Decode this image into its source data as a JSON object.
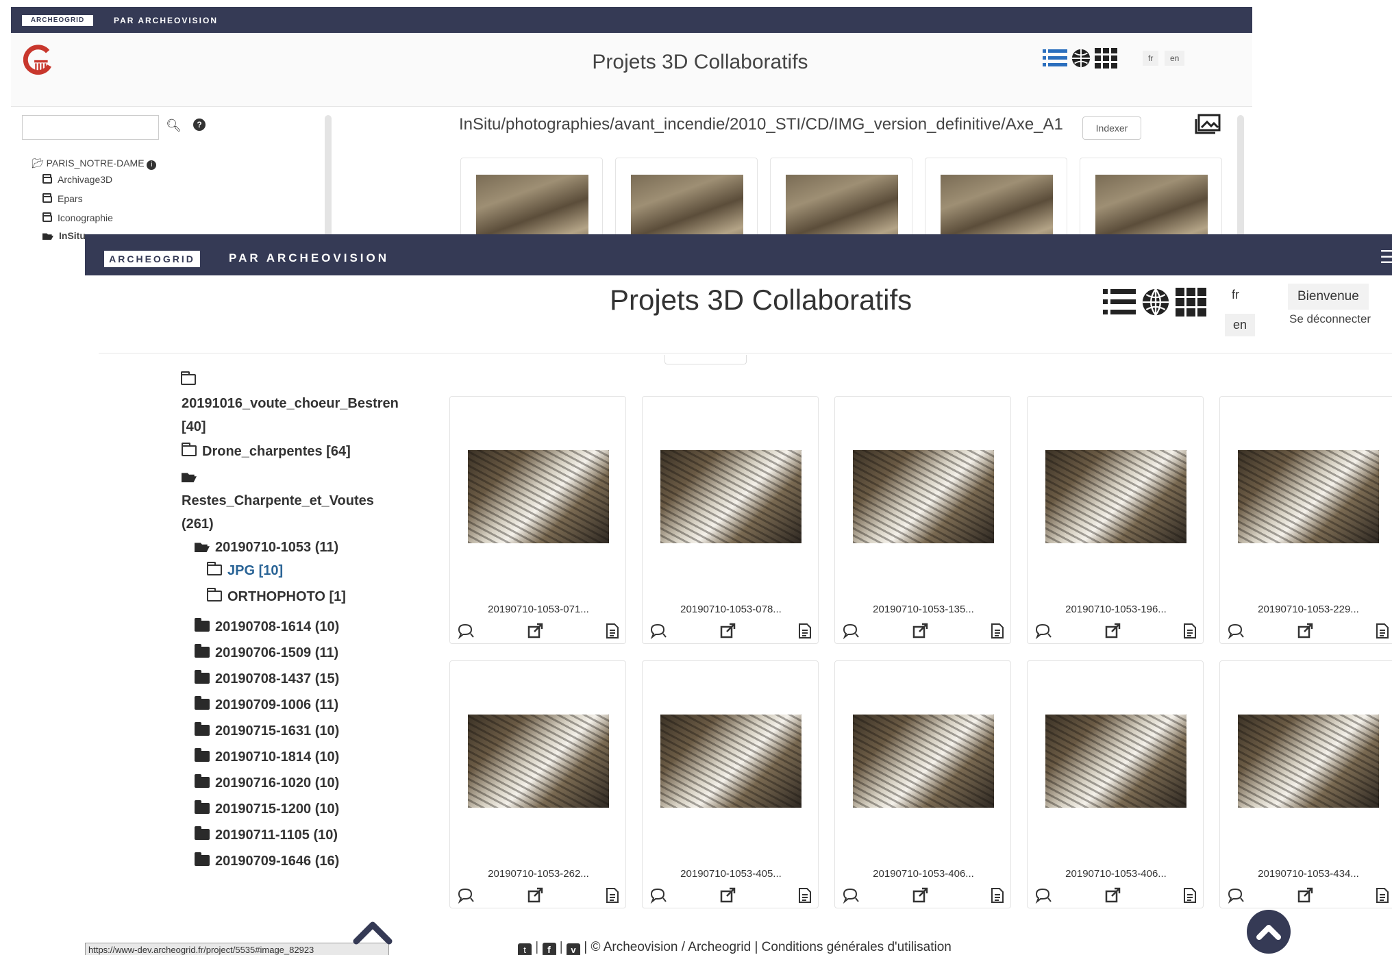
{
  "back": {
    "brand": "ARCHEOGRID",
    "brand_par": "PAR ARCHEOVISION",
    "title": "Projets 3D Collaboratifs",
    "lang_fr": "fr",
    "lang_en": "en",
    "tree": [
      "PARIS_NOTRE-DAME",
      "Archivage3D",
      "Epars",
      "Iconographie",
      "InSitu"
    ],
    "path": "InSitu/photographies/avant_incendie/2010_STI/CD/IMG_version_definitive/Axe_A1",
    "indexer_label": "Indexer"
  },
  "front": {
    "brand": "ARCHEOGRID",
    "brand_par": "PAR ARCHEOVISION",
    "title": "Projets 3D Collaboratifs",
    "lang_fr": "fr",
    "lang_en": "en",
    "welcome": "Bienvenue",
    "logout": "Se déconnecter",
    "tree": [
      {
        "label": "20191016_voute_choeur_Bestren",
        "icon": "folder-icon"
      },
      {
        "label": "[40]"
      },
      {
        "label": "Drone_charpentes [64]",
        "icon": "folder-icon"
      },
      {
        "label": "Restes_Charpente_et_Voutes",
        "icon": "folder-open-icon"
      },
      {
        "label": "(261)"
      },
      {
        "label": "20190710-1053 (11)",
        "icon": "folder-open-icon"
      },
      {
        "label": "JPG [10]",
        "icon": "folder-icon"
      },
      {
        "label": "ORTHOPHOTO [1]",
        "icon": "folder-icon"
      },
      {
        "label": "20190708-1614 (10)",
        "icon": "folder-solid-icon"
      },
      {
        "label": "20190706-1509 (11)",
        "icon": "folder-solid-icon"
      },
      {
        "label": "20190708-1437 (15)",
        "icon": "folder-solid-icon"
      },
      {
        "label": "20190709-1006 (11)",
        "icon": "folder-solid-icon"
      },
      {
        "label": "20190715-1631 (10)",
        "icon": "folder-solid-icon"
      },
      {
        "label": "20190710-1814 (10)",
        "icon": "folder-solid-icon"
      },
      {
        "label": "20190716-1020 (10)",
        "icon": "folder-solid-icon"
      },
      {
        "label": "20190715-1200 (10)",
        "icon": "folder-solid-icon"
      },
      {
        "label": "20190711-1105 (10)",
        "icon": "folder-solid-icon"
      },
      {
        "label": "20190709-1646 (16)",
        "icon": "folder-solid-icon"
      }
    ],
    "cards": [
      {
        "name": "20190710-1053-071..."
      },
      {
        "name": "20190710-1053-078..."
      },
      {
        "name": "20190710-1053-135..."
      },
      {
        "name": "20190710-1053-196..."
      },
      {
        "name": "20190710-1053-229..."
      },
      {
        "name": "20190710-1053-262..."
      },
      {
        "name": "20190710-1053-405..."
      },
      {
        "name": "20190710-1053-406..."
      },
      {
        "name": "20190710-1053-406..."
      },
      {
        "name": "20190710-1053-434..."
      }
    ],
    "footer": "| © Archeovision / Archeogrid | Conditions générales d'utilisation",
    "status_url": "https://www-dev.archeogrid.fr/project/5535#image_82923"
  },
  "colors": {
    "navbar": "#353a55",
    "logo_red": "#c8372d",
    "link": "#2a6496"
  }
}
